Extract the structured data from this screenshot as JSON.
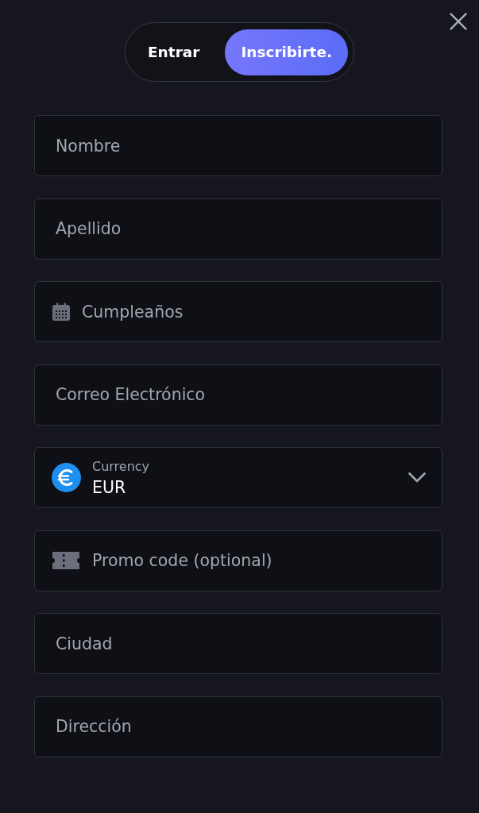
{
  "tabs": [
    {
      "label": "Entrar",
      "selected": false
    },
    {
      "label": "Inscribirte.",
      "selected": true
    }
  ],
  "fields": [
    {
      "kind": "text",
      "placeholder": "Nombre"
    },
    {
      "kind": "text",
      "placeholder": "Apellido"
    },
    {
      "kind": "date",
      "placeholder": "Cumpleaños"
    },
    {
      "kind": "text",
      "placeholder": "Correo Electrónico"
    },
    {
      "kind": "select",
      "label": "Currency",
      "value": "EUR"
    },
    {
      "kind": "promo",
      "placeholder": "Promo code (optional)"
    },
    {
      "kind": "text",
      "placeholder": "Ciudad"
    },
    {
      "kind": "text",
      "placeholder": "Dirección"
    }
  ]
}
